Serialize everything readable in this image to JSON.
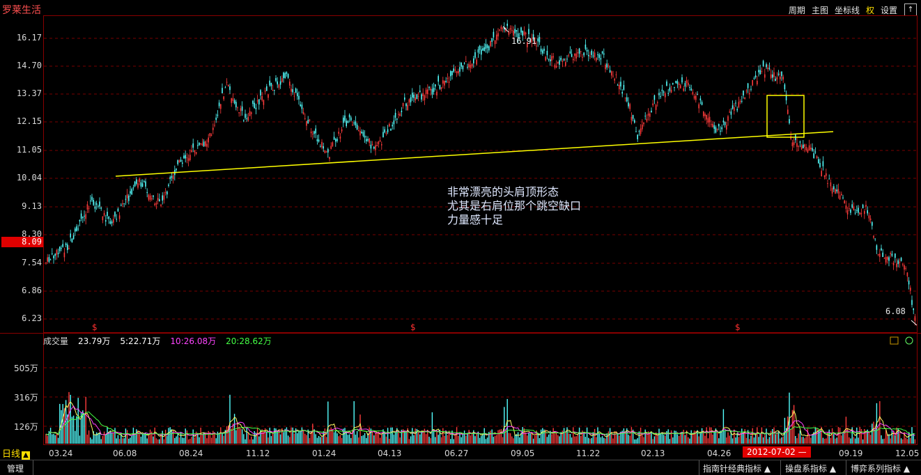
{
  "stock_name": "罗莱生活",
  "toolbar": [
    "周期",
    "主图",
    "坐标线",
    "权",
    "设置"
  ],
  "up_button": "↑",
  "price_axis": [
    "16.17",
    "14.70",
    "13.37",
    "12.15",
    "11.05",
    "10.04",
    "9.13",
    "8.30",
    "7.54",
    "6.86",
    "6.23"
  ],
  "current_price": "8.09",
  "high_label": "16.91",
  "low_label": "6.08",
  "annotation": [
    "非常漂亮的头肩顶形态",
    "尤其是右肩位那个跳空缺口",
    "力量感十足"
  ],
  "event_marker": "$",
  "volume": {
    "name": "成交量",
    "value": "23.79万",
    "ma5": "5:22.71万",
    "ma10": "10:26.08万",
    "ma20": "20:28.62万",
    "axis": [
      "505万",
      "316万",
      "126万"
    ]
  },
  "period": "日线",
  "period_icon": "▲",
  "dates": [
    "03.24",
    "06.08",
    "08.24",
    "11.12",
    "01.24",
    "04.13",
    "06.27",
    "09.05",
    "11.22",
    "02.13",
    "04.26",
    "09.19",
    "12.05"
  ],
  "highlight_date": "2012-07-02",
  "highlight_suffix": "—",
  "status": {
    "manage": "管理",
    "indicators": [
      "指南针经典指标 ▲",
      "操盘系指标 ▲",
      "博弈系列指标 ▲"
    ]
  },
  "colors": {
    "up": "#ff3c3c",
    "down": "#54ffff",
    "neckline": "#ffff00",
    "grid": "#7a0000"
  }
}
